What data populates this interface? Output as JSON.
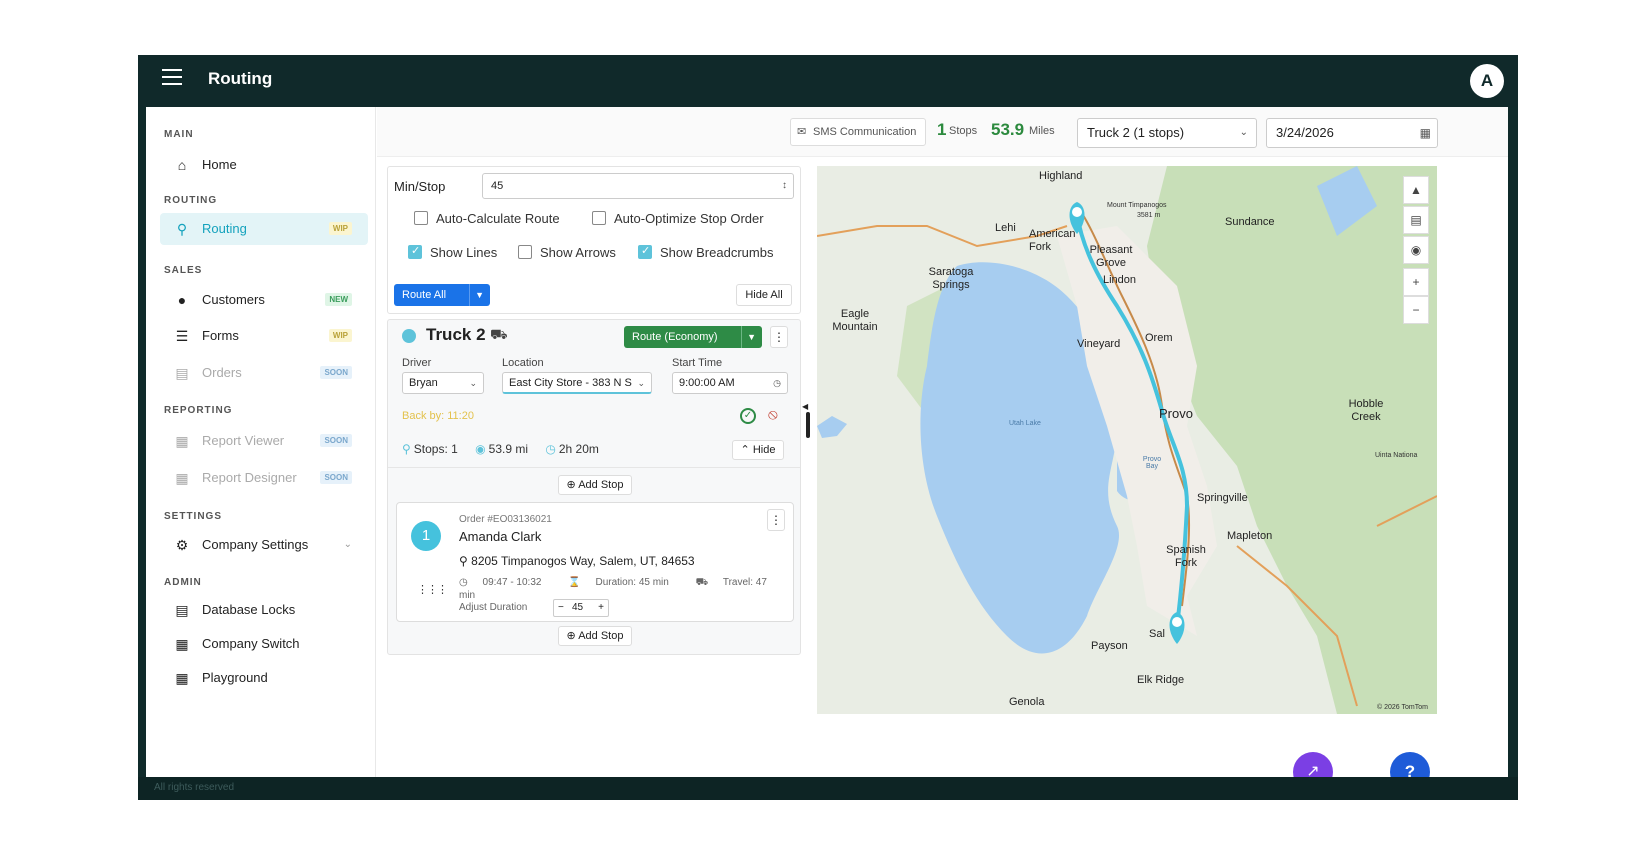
{
  "topbar": {
    "title": "Routing",
    "avatar": "A"
  },
  "sidebar": {
    "sections": {
      "main": "MAIN",
      "routing": "ROUTING",
      "sales": "SALES",
      "reporting": "REPORTING",
      "settings": "SETTINGS",
      "admin": "ADMIN"
    },
    "items": {
      "home": {
        "label": "Home",
        "icon": "home-icon"
      },
      "routing": {
        "label": "Routing",
        "badge": "WIP",
        "icon": "map-pin-icon"
      },
      "customers": {
        "label": "Customers",
        "badge": "NEW",
        "icon": "person-icon"
      },
      "forms": {
        "label": "Forms",
        "badge": "WIP",
        "icon": "form-icon"
      },
      "orders": {
        "label": "Orders",
        "badge": "SOON",
        "icon": "cart-icon"
      },
      "report_viewer": {
        "label": "Report Viewer",
        "badge": "SOON",
        "icon": "report-icon"
      },
      "report_designer": {
        "label": "Report Designer",
        "badge": "SOON",
        "icon": "report-icon"
      },
      "company_settings": {
        "label": "Company Settings",
        "icon": "gear-icon"
      },
      "database_locks": {
        "label": "Database Locks",
        "icon": "database-icon"
      },
      "company_switch": {
        "label": "Company Switch",
        "icon": "building-icon"
      },
      "playground": {
        "label": "Playground",
        "icon": "playground-icon"
      }
    }
  },
  "header": {
    "sms_label": "SMS Communication",
    "stops_count": "1",
    "stops_label": "Stops",
    "miles_value": "53.9",
    "miles_label": "Miles",
    "truck_select": "Truck 2 (1 stops)",
    "date": "3/24/2026"
  },
  "options": {
    "min_stop_label": "Min/Stop",
    "min_stop_value": "45",
    "auto_calc": "Auto-Calculate Route",
    "auto_opt": "Auto-Optimize Stop Order",
    "show_lines": "Show Lines",
    "show_arrows": "Show Arrows",
    "show_breadcrumbs": "Show Breadcrumbs",
    "route_all": "Route All",
    "hide_all": "Hide All"
  },
  "truck": {
    "name": "Truck 2",
    "route_btn": "Route (Economy)",
    "driver_label": "Driver",
    "driver_value": "Bryan",
    "location_label": "Location",
    "location_value": "East City Store - 383 N S",
    "start_label": "Start Time",
    "start_value": "9:00:00 AM",
    "back_by": "Back by: 11:20",
    "stops": "Stops: 1",
    "distance": "53.9 mi",
    "duration": "2h 20m",
    "hide": "Hide",
    "add_stop": "Add Stop"
  },
  "stop": {
    "number": "1",
    "order": "Order #EO03136021",
    "customer": "Amanda Clark",
    "address": "8205 Timpanogos Way, Salem, UT, 84653",
    "time_range": "09:47 - 10:32",
    "duration": "Duration: 45 min",
    "travel": "Travel: 47 min",
    "adjust_label": "Adjust Duration",
    "adjust_value": "45"
  },
  "map": {
    "labels": {
      "highland": "Highland",
      "mount_timp": "Mount Timpanogos",
      "mount_timp_elev": "3581 m",
      "sundance": "Sundance",
      "lehi": "Lehi",
      "american_fork": "American Fork",
      "pleasant_grove": "Pleasant Grove",
      "lindon": "Lindon",
      "saratoga": "Saratoga Springs",
      "eagle_mountain": "Eagle Mountain",
      "vineyard": "Vineyard",
      "orem": "Orem",
      "provo": "Provo",
      "hobble_creek": "Hobble Creek",
      "utah_lake": "Utah Lake",
      "provo_bay": "Provo Bay",
      "uinta": "Uinta Nationa",
      "springville": "Springville",
      "mapleton": "Mapleton",
      "spanish_fork": "Spanish Fork",
      "payson": "Payson",
      "salem": "Sal",
      "elk_ridge": "Elk Ridge",
      "genola": "Genola",
      "copyright": "© 2026 TomTom"
    }
  },
  "footer": {
    "text": "All rights reserved"
  },
  "colors": {
    "brand": "#10292a",
    "accent": "#14a2bd",
    "route_line": "#45c2dd",
    "green": "#2e8b46"
  }
}
